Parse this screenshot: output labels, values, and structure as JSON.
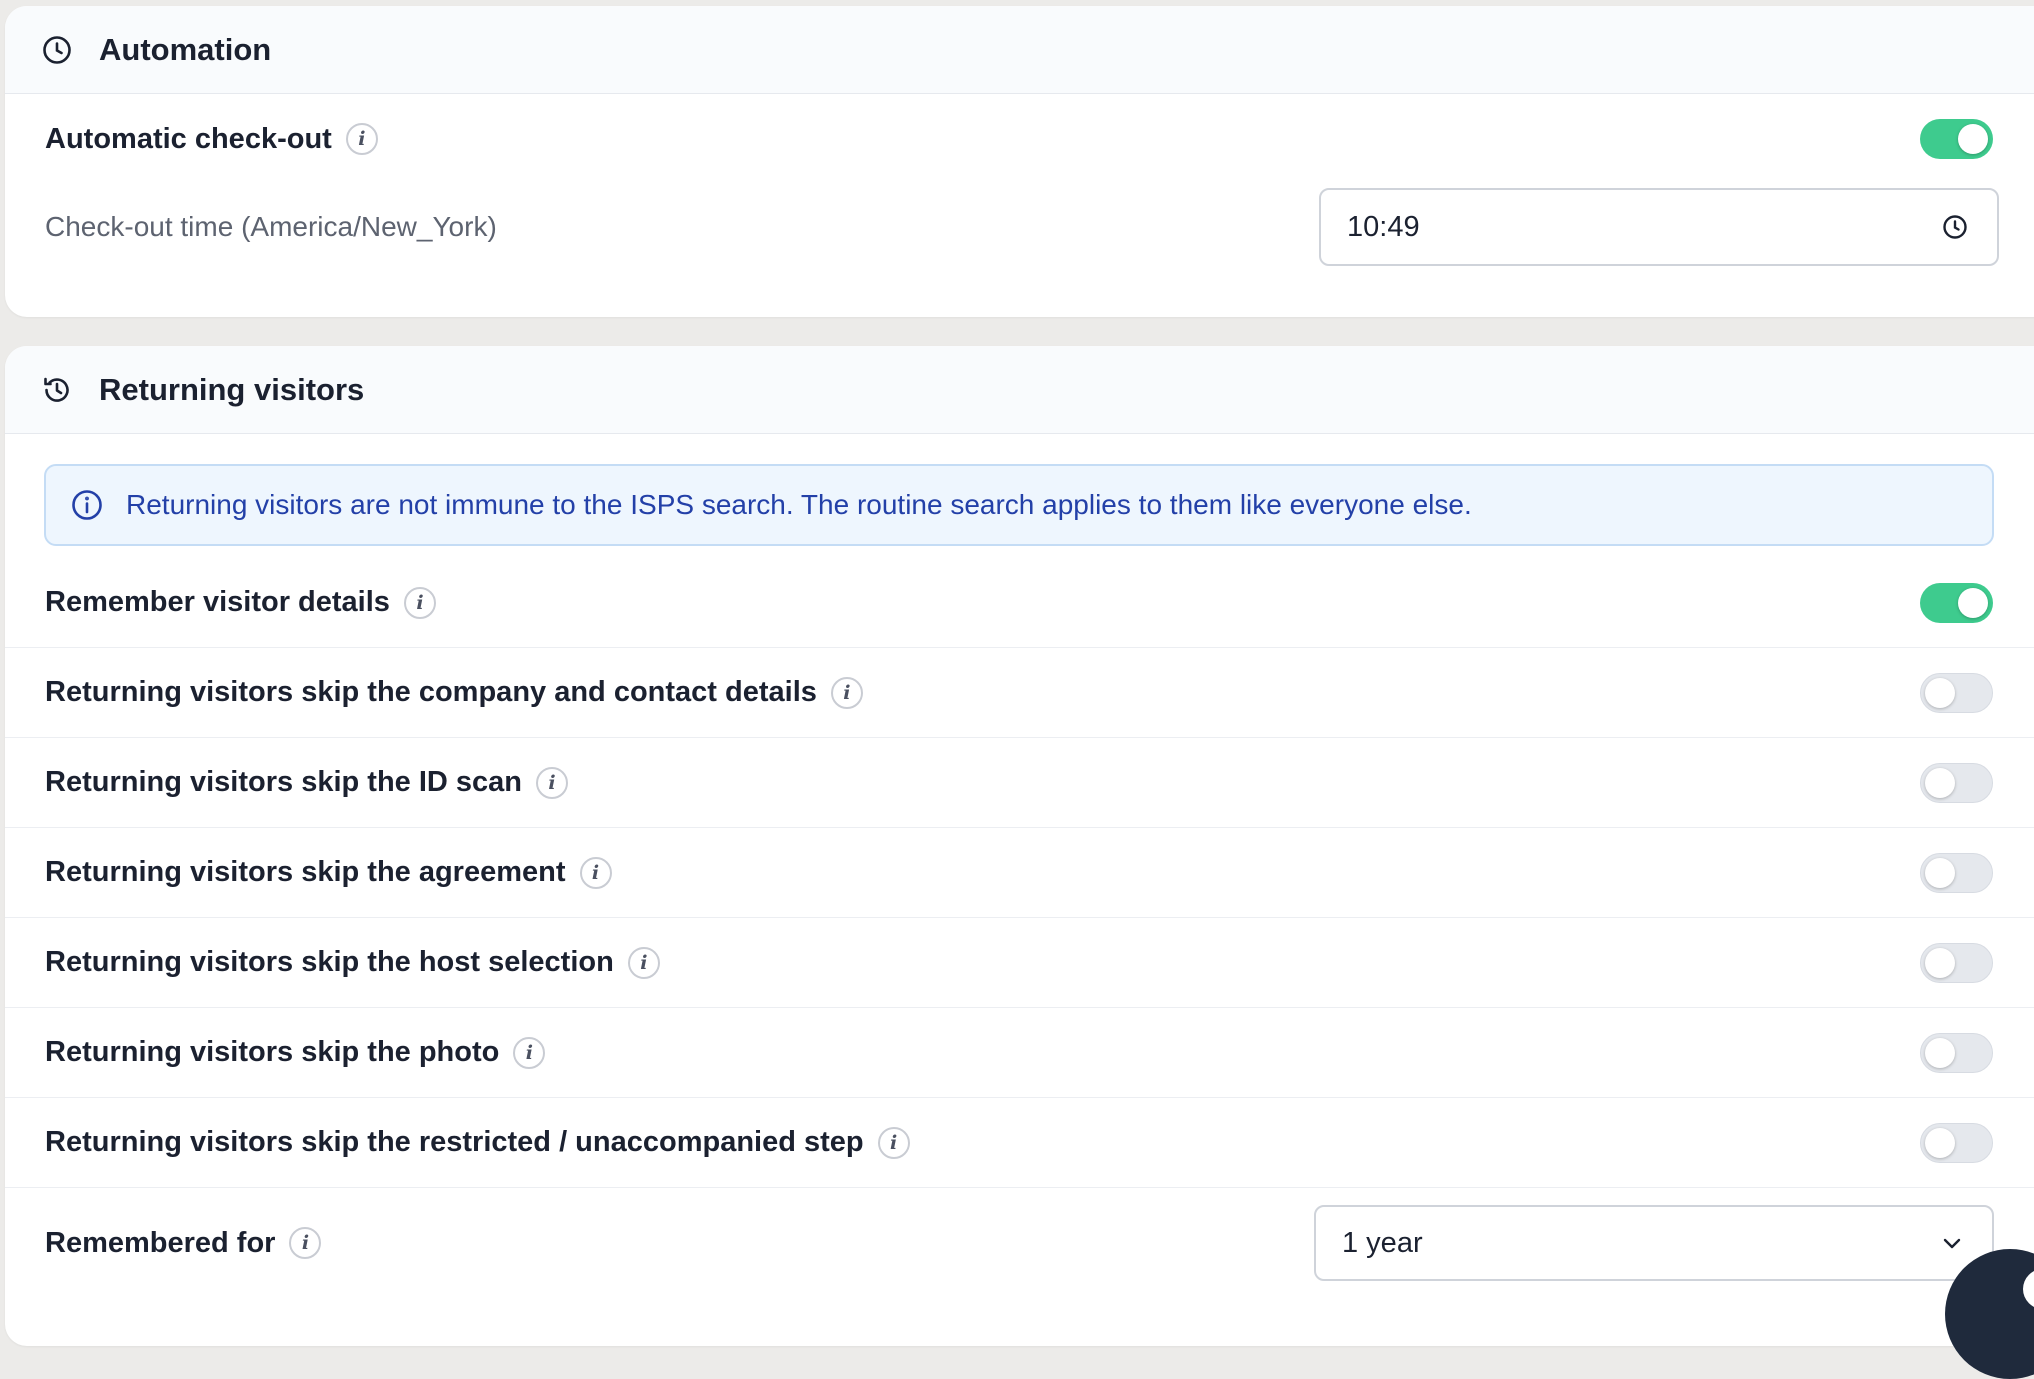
{
  "automation": {
    "title": "Automation",
    "auto_checkout": {
      "label": "Automatic check-out",
      "enabled": true
    },
    "checkout_time": {
      "label": "Check-out time (America/New_York)",
      "value": "10:49"
    }
  },
  "returning": {
    "title": "Returning visitors",
    "notice": "Returning visitors are not immune to the ISPS search. The routine search applies to them like everyone else.",
    "settings": [
      {
        "label": "Remember visitor details",
        "enabled": true
      },
      {
        "label": "Returning visitors skip the company and contact details",
        "enabled": false
      },
      {
        "label": "Returning visitors skip the ID scan",
        "enabled": false
      },
      {
        "label": "Returning visitors skip the agreement",
        "enabled": false
      },
      {
        "label": "Returning visitors skip the host selection",
        "enabled": false
      },
      {
        "label": "Returning visitors skip the photo",
        "enabled": false
      },
      {
        "label": "Returning visitors skip the restricted / unaccompanied step",
        "enabled": false
      }
    ],
    "remembered_for": {
      "label": "Remembered for",
      "value": "1 year"
    }
  },
  "colors": {
    "toggle_on": "#3ecb8e",
    "toggle_off": "#e5e8ed",
    "notice_text": "#2340a8",
    "notice_bg": "#eef6fe"
  },
  "icons": {
    "automation": "clock-icon",
    "returning": "history-icon",
    "info": "info-icon",
    "time_field": "clock-icon",
    "select": "chevron-down-icon"
  }
}
